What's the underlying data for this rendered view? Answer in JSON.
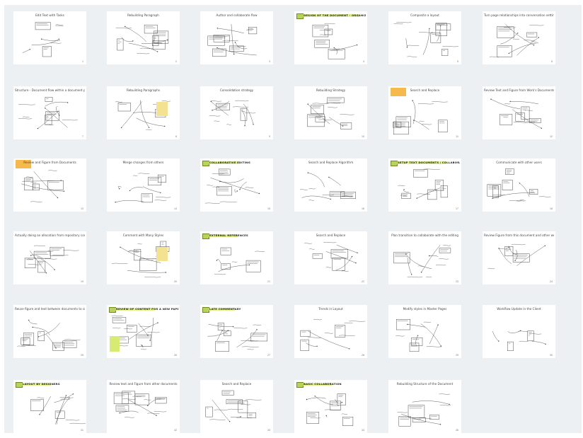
{
  "colors": {
    "board": "#edf0f2",
    "card": "#ffffff",
    "sketch_ink": "#3a3a3a",
    "sticky_orange": "#f6b94c",
    "sticky_yellow": "#f3e391",
    "highlight_green": "#d9ec6a",
    "badge_green": "#b7d35a"
  },
  "slides": [
    {
      "title": "Edit Text with Tasks",
      "badge": false,
      "sticky": "none",
      "num": "1"
    },
    {
      "title": "Rebuilding Paragraph",
      "badge": false,
      "sticky": "none",
      "num": "2"
    },
    {
      "title": "Author and collaborate flow",
      "badge": false,
      "sticky": "none",
      "num": "3"
    },
    {
      "title": "DESIGN OF THE DOCUMENT - ORGANIZATION, LAYERS AND PROCESS",
      "badge": true,
      "sticky": "none",
      "num": "4"
    },
    {
      "title": "Composite a layout",
      "badge": false,
      "sticky": "none",
      "num": "5"
    },
    {
      "title": "Turn page relationships into conversation settings",
      "badge": false,
      "sticky": "none",
      "num": "6"
    },
    {
      "title": "Structure - Document flow within a document page",
      "badge": false,
      "sticky": "none",
      "num": "7"
    },
    {
      "title": "Rebuilding Paragraphs",
      "badge": false,
      "sticky": "light",
      "num": "8"
    },
    {
      "title": "Consolidation strategy",
      "badge": false,
      "sticky": "none",
      "num": "9"
    },
    {
      "title": "Rebuilding Strategy",
      "badge": false,
      "sticky": "none",
      "num": "10"
    },
    {
      "title": "Search and Replace",
      "badge": false,
      "sticky": "orange",
      "num": "11"
    },
    {
      "title": "Review Text and Figure from Work's Documents",
      "badge": false,
      "sticky": "none",
      "num": "12"
    },
    {
      "title": "Review and Figure from Documents",
      "badge": false,
      "sticky": "orange",
      "num": "13"
    },
    {
      "title": "Merge changes from others",
      "badge": false,
      "sticky": "none",
      "num": "14"
    },
    {
      "title": "COLLABORATIVE EDITING",
      "badge": true,
      "sticky": "none",
      "num": "15"
    },
    {
      "title": "Search and Replace Algorithm",
      "badge": false,
      "sticky": "none",
      "num": "16"
    },
    {
      "title": "SETUP TEXT DOCUMENTS / COLLABORATIVE WORKFLOW",
      "badge": true,
      "sticky": "none",
      "num": "17"
    },
    {
      "title": "Communicate with other users",
      "badge": false,
      "sticky": "none",
      "num": "18"
    },
    {
      "title": "Actually doing an allocation from repository content",
      "badge": false,
      "sticky": "none",
      "num": "19"
    },
    {
      "title": "Comment with Many Styles",
      "badge": false,
      "sticky": "light",
      "num": "20"
    },
    {
      "title": "EXTERNAL REFERENCES",
      "badge": true,
      "sticky": "none",
      "num": "21"
    },
    {
      "title": "Search and Replace",
      "badge": false,
      "sticky": "none",
      "num": "22"
    },
    {
      "title": "Plan transition to collaborate with the editing",
      "badge": false,
      "sticky": "none",
      "num": "23"
    },
    {
      "title": "Review Figure from this document and other working templates",
      "badge": false,
      "sticky": "none",
      "num": "24"
    },
    {
      "title": "Reuse figure and text between documents to create a different version",
      "badge": false,
      "sticky": "none",
      "num": "25"
    },
    {
      "title": "REVIEW OF CONTENT FOR A NEW PAPER",
      "badge": true,
      "sticky": "green",
      "num": "26"
    },
    {
      "title": "LATE COMMENTARY",
      "badge": true,
      "sticky": "none",
      "num": "27"
    },
    {
      "title": "Trends in Layout",
      "badge": false,
      "sticky": "none",
      "num": "28"
    },
    {
      "title": "Modify styles in Master Pages",
      "badge": false,
      "sticky": "none",
      "num": "29"
    },
    {
      "title": "Workflow Update in the Client",
      "badge": false,
      "sticky": "none",
      "num": "30"
    },
    {
      "title": "LAYOUT BY DESIGNERS",
      "badge": true,
      "sticky": "none",
      "num": "31"
    },
    {
      "title": "Review text and Figure from other documents",
      "badge": false,
      "sticky": "none",
      "num": "32"
    },
    {
      "title": "Search and Replace",
      "badge": false,
      "sticky": "none",
      "num": "33"
    },
    {
      "title": "BASIC COLLABORATION",
      "badge": true,
      "sticky": "none",
      "num": "34"
    },
    {
      "title": "Rebuilding Structure of the Document",
      "badge": false,
      "sticky": "none",
      "num": "35"
    }
  ]
}
